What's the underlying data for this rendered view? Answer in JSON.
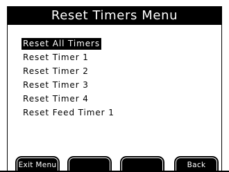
{
  "header": {
    "title": "Reset Timers Menu"
  },
  "menu": {
    "items": [
      {
        "label": "Reset All Timers",
        "selected": true
      },
      {
        "label": "Reset Timer 1",
        "selected": false
      },
      {
        "label": "Reset Timer 2",
        "selected": false
      },
      {
        "label": "Reset Timer 3",
        "selected": false
      },
      {
        "label": "Reset Timer 4",
        "selected": false
      },
      {
        "label": "Reset Feed Timer 1",
        "selected": false
      }
    ]
  },
  "softkeys": [
    {
      "label": "Exit Menu"
    },
    {
      "label": ""
    },
    {
      "label": ""
    },
    {
      "label": "Back"
    }
  ],
  "colors": {
    "background": "#ffffff",
    "foreground": "#000000"
  }
}
